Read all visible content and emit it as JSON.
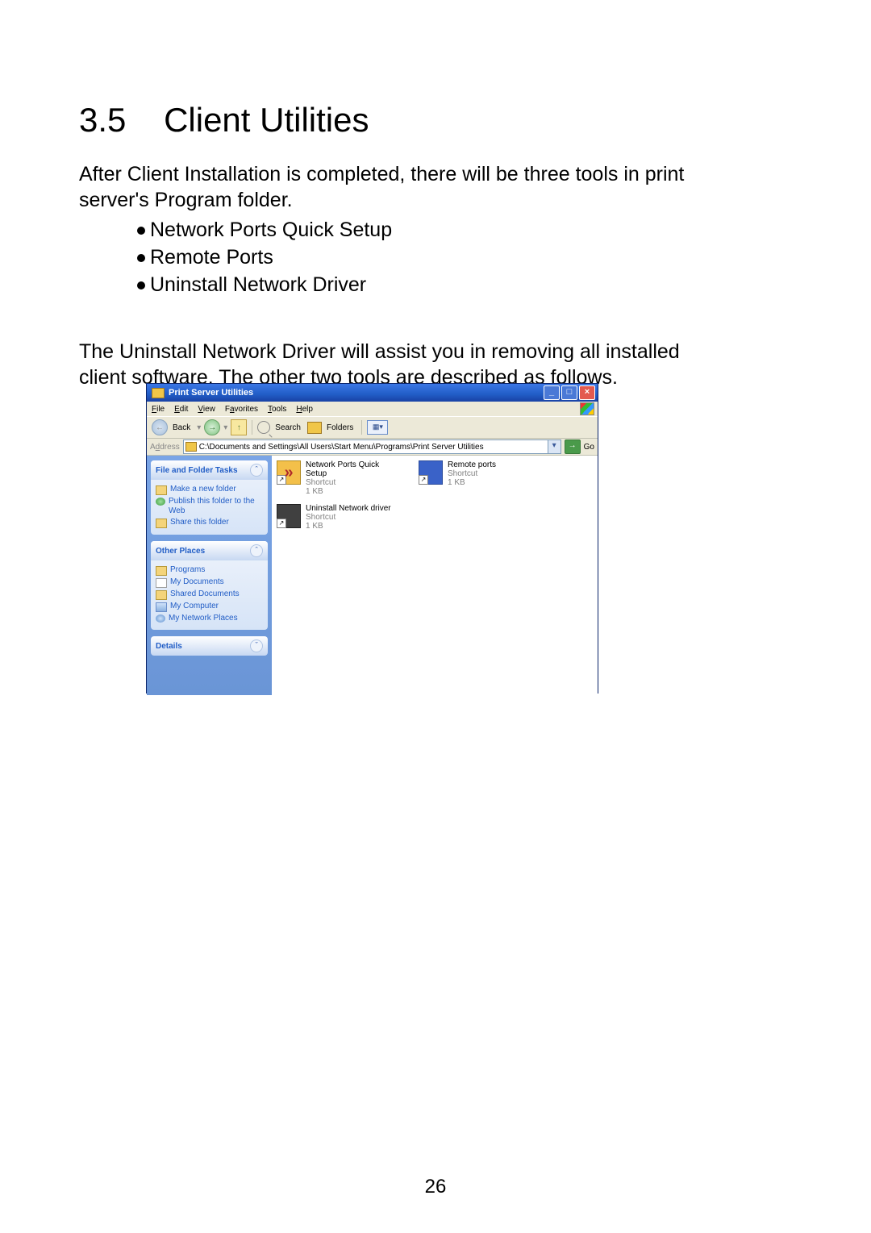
{
  "doc": {
    "heading_num": "3.5",
    "heading_title": "Client Utilities",
    "intro": "After Client Installation is completed, there will be three tools in print server's Program folder.",
    "bullets": [
      "Network Ports Quick Setup",
      "Remote Ports",
      "Uninstall Network Driver"
    ],
    "para2": "The Uninstall Network Driver will assist you in removing all installed client software. The other two tools are described as follows.",
    "page_number": "26"
  },
  "window": {
    "title": "Print Server Utilities",
    "menu": {
      "file": "File",
      "edit": "Edit",
      "view": "View",
      "favorites": "Favorites",
      "tools": "Tools",
      "help": "Help"
    },
    "toolbar": {
      "back": "Back",
      "search": "Search",
      "folders": "Folders"
    },
    "address": {
      "label": "Address",
      "path": "C:\\Documents and Settings\\All Users\\Start Menu\\Programs\\Print Server Utilities",
      "go": "Go"
    },
    "side": {
      "file_tasks": {
        "title": "File and Folder Tasks",
        "make_folder": "Make a new folder",
        "publish": "Publish this folder to the Web",
        "share": "Share this folder"
      },
      "other_places": {
        "title": "Other Places",
        "programs": "Programs",
        "my_documents": "My Documents",
        "shared_documents": "Shared Documents",
        "my_computer": "My Computer",
        "my_network_places": "My Network Places"
      },
      "details": {
        "title": "Details"
      }
    },
    "files": [
      {
        "name": "Network Ports Quick Setup",
        "type": "Shortcut",
        "size": "1 KB",
        "icon": "qs"
      },
      {
        "name": "Remote ports",
        "type": "Shortcut",
        "size": "1 KB",
        "icon": "rp"
      },
      {
        "name": "Uninstall Network driver",
        "type": "Shortcut",
        "size": "1 KB",
        "icon": "un"
      }
    ]
  }
}
